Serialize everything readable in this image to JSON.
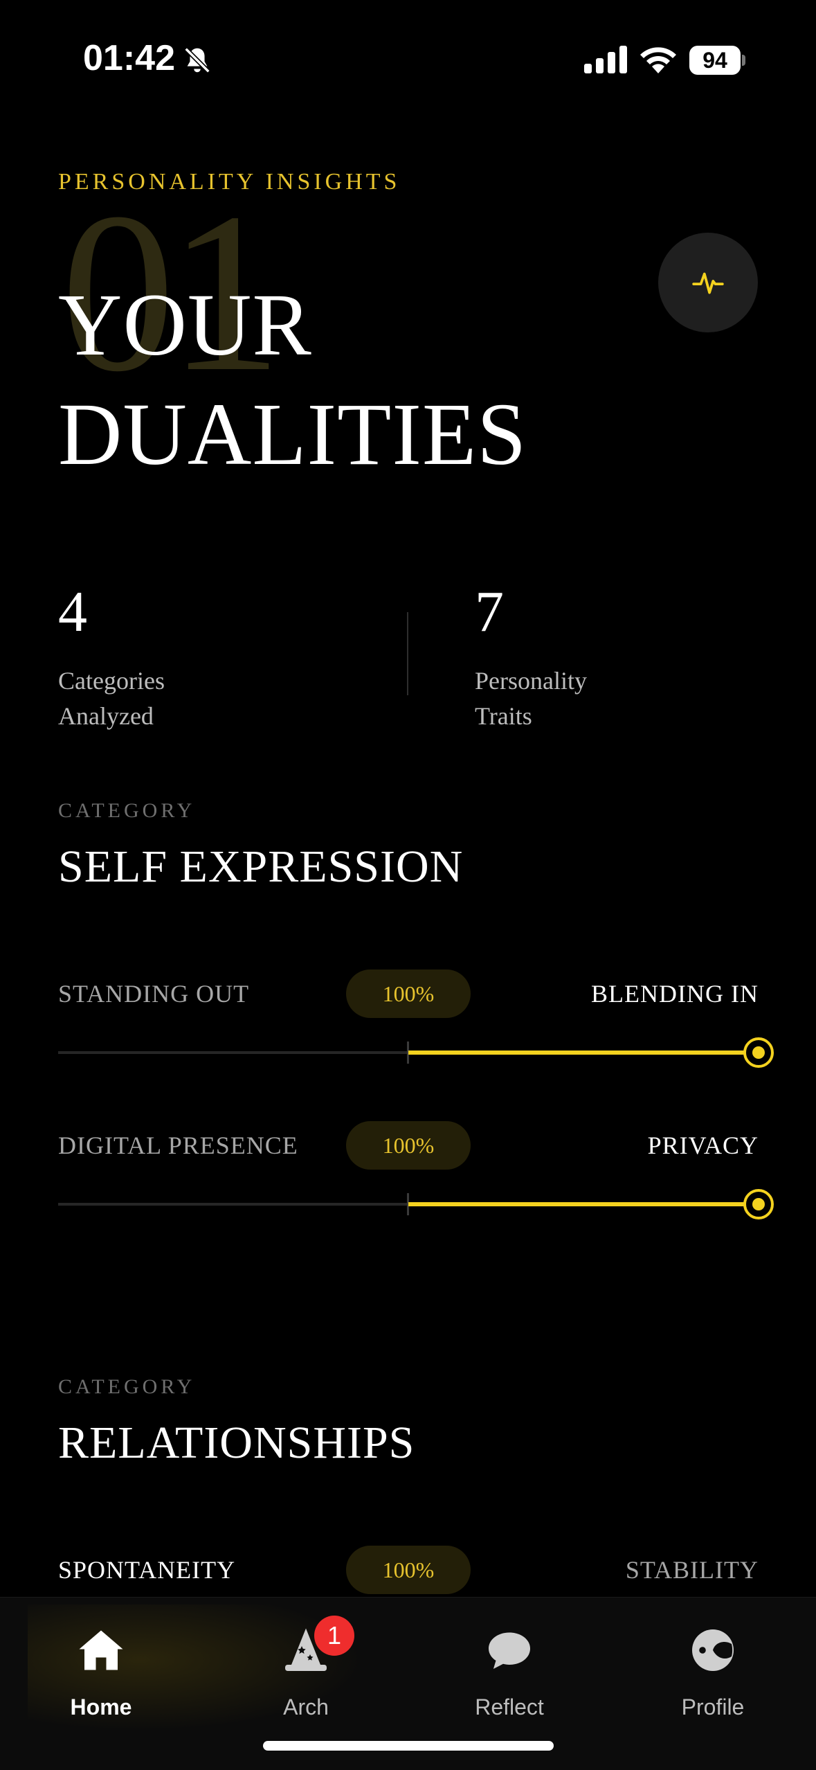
{
  "status": {
    "time": "01:42",
    "battery": "94"
  },
  "header": {
    "eyebrow": "PERSONALITY INSIGHTS",
    "index_number": "01",
    "title_line1": "YOUR",
    "title_line2": "DUALITIES",
    "action_icon": "activity-pulse-icon"
  },
  "stats": [
    {
      "value": "4",
      "label_line1": "Categories",
      "label_line2": "Analyzed"
    },
    {
      "value": "7",
      "label_line1": "Personality",
      "label_line2": "Traits"
    }
  ],
  "categories": [
    {
      "eyebrow": "CATEGORY",
      "title": "SELF EXPRESSION",
      "traits": [
        {
          "left": "STANDING OUT",
          "percent": "100%",
          "right": "BLENDING IN",
          "value": 1.0
        },
        {
          "left": "DIGITAL PRESENCE",
          "percent": "100%",
          "right": "PRIVACY",
          "value": 1.0
        }
      ]
    },
    {
      "eyebrow": "CATEGORY",
      "title": "RELATIONSHIPS",
      "traits": [
        {
          "left": "SPONTANEITY",
          "percent": "100%",
          "right": "STABILITY",
          "value": 1.0
        }
      ]
    }
  ],
  "tabs": [
    {
      "label": "Home",
      "icon": "home-icon",
      "active": true
    },
    {
      "label": "Arch",
      "icon": "wizard-hat-icon",
      "badge": "1"
    },
    {
      "label": "Reflect",
      "icon": "chat-bubble-icon"
    },
    {
      "label": "Profile",
      "icon": "profile-face-icon"
    }
  ],
  "colors": {
    "accent": "#f4d21f",
    "background": "#000000",
    "badge": "#ef2d2d"
  }
}
